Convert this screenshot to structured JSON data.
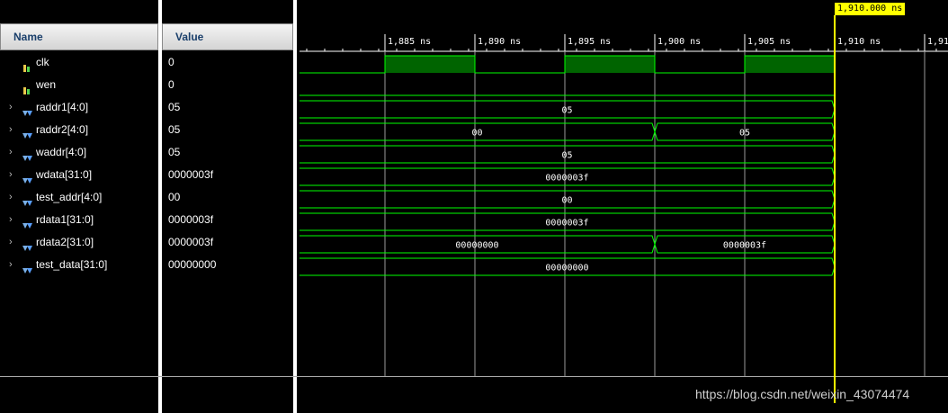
{
  "headers": {
    "name": "Name",
    "value": "Value"
  },
  "cursor_label": "1,910.000 ns",
  "timeline": {
    "ticks": [
      "1,885 ns",
      "1,890 ns",
      "1,895 ns",
      "1,900 ns",
      "1,905 ns",
      "1,910 ns",
      "1,91"
    ]
  },
  "signals": [
    {
      "name": "clk",
      "value": "0",
      "type": "bit",
      "expandable": false
    },
    {
      "name": "wen",
      "value": "0",
      "type": "bit",
      "expandable": false
    },
    {
      "name": "raddr1[4:0]",
      "value": "05",
      "type": "bus",
      "expandable": true,
      "segments": [
        "05"
      ]
    },
    {
      "name": "raddr2[4:0]",
      "value": "05",
      "type": "bus",
      "expandable": true,
      "segments": [
        "00",
        "05"
      ]
    },
    {
      "name": "waddr[4:0]",
      "value": "05",
      "type": "bus",
      "expandable": true,
      "segments": [
        "05"
      ]
    },
    {
      "name": "wdata[31:0]",
      "value": "0000003f",
      "type": "bus",
      "expandable": true,
      "segments": [
        "0000003f"
      ]
    },
    {
      "name": "test_addr[4:0]",
      "value": "00",
      "type": "bus",
      "expandable": true,
      "segments": [
        "00"
      ]
    },
    {
      "name": "rdata1[31:0]",
      "value": "0000003f",
      "type": "bus",
      "expandable": true,
      "segments": [
        "0000003f"
      ]
    },
    {
      "name": "rdata2[31:0]",
      "value": "0000003f",
      "type": "bus",
      "expandable": true,
      "segments": [
        "00000000",
        "0000003f"
      ]
    },
    {
      "name": "test_data[31:0]",
      "value": "00000000",
      "type": "bus",
      "expandable": true,
      "segments": [
        "00000000"
      ]
    }
  ],
  "watermark": "https://blog.csdn.net/weixin_43074474",
  "colors": {
    "wave": "#00ff00",
    "clk_high_fill": "#006400",
    "cursor": "#ffff00",
    "grid": "#ffffff"
  }
}
